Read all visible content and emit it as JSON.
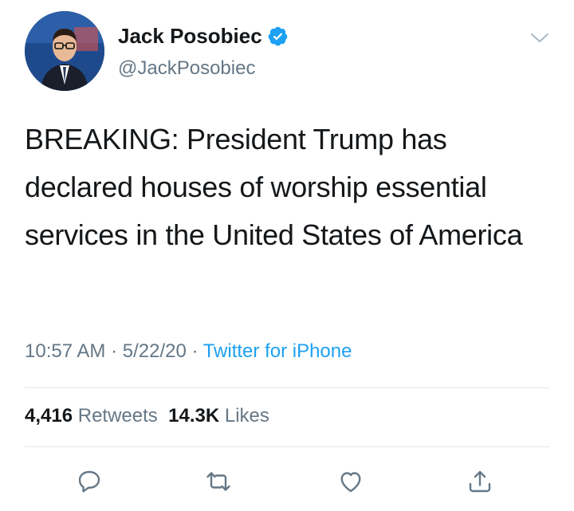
{
  "author": {
    "name": "Jack Posobiec",
    "handle": "@JackPosobiec",
    "verified": true
  },
  "tweet": {
    "text": "BREAKING: President Trump has declared houses of worship essential services in the United States of America",
    "time": "10:57 AM",
    "date": "5/22/20",
    "source": "Twitter for iPhone",
    "separator": " · "
  },
  "stats": {
    "retweets_count": "4,416",
    "retweets_label": "Retweets",
    "likes_count": "14.3K",
    "likes_label": "Likes"
  },
  "actions": [
    "reply-icon",
    "retweet-icon",
    "like-icon",
    "share-icon"
  ],
  "colors": {
    "accent": "#1da1f2",
    "secondary_text": "#657786",
    "divider": "#e1e8ed"
  }
}
